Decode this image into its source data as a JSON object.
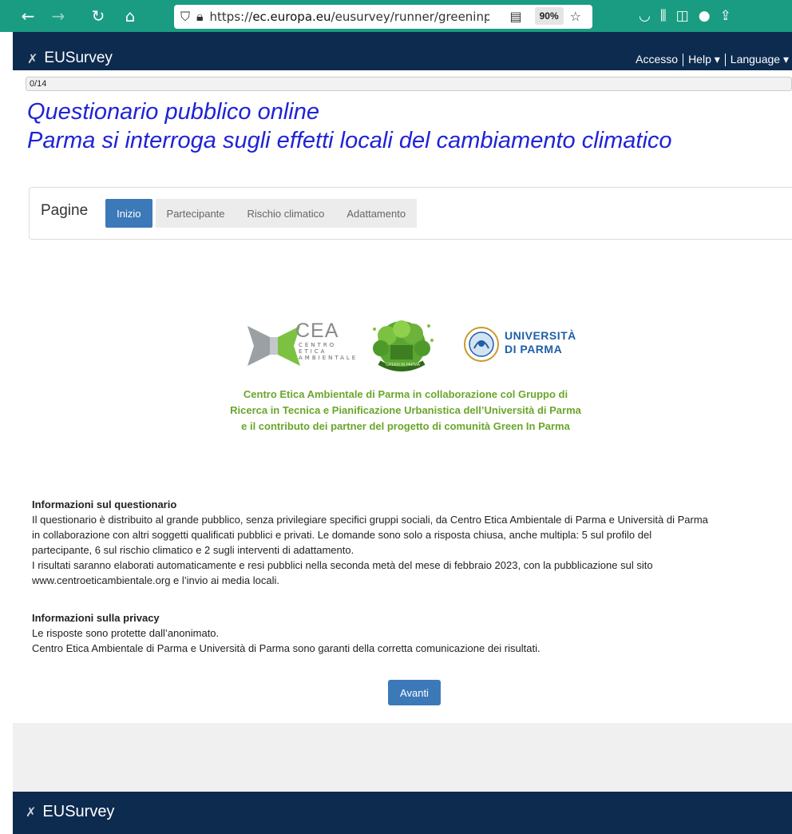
{
  "browser": {
    "url_prefix": "https://",
    "url_domain": "ec.europa.eu",
    "url_path": "/eusurvey/runner/greeninpar",
    "zoom": "90%"
  },
  "header": {
    "brand": "EUSurvey",
    "menu": [
      "Accesso",
      "Help ▾",
      "Language ▾"
    ]
  },
  "progress": {
    "label": "0/14",
    "value": 0
  },
  "survey": {
    "title_line1": "Questionario pubblico online",
    "title_line2": "Parma si interroga sugli effetti locali del cambiamento climatico"
  },
  "pages": {
    "label": "Pagine",
    "tabs": [
      "Inizio",
      "Partecipante",
      "Rischio climatico",
      "Adattamento"
    ],
    "active": "Inizio"
  },
  "logos": {
    "cea": "CEA",
    "cea_sub": [
      "CENTRO",
      "ETICA",
      "AMBIENTALE"
    ],
    "green": "GREEN IN PARMA",
    "uni": [
      "UNIVERSITÀ",
      "DI PARMA"
    ]
  },
  "partners": [
    "Centro Etica Ambientale di Parma in collaborazione col Gruppo di",
    "Ricerca in Tecnica e Pianificazione Urbanistica dell’Università di Parma",
    "e il contributo dei partner del progetto di comunità Green In Parma"
  ],
  "info_questionario": {
    "heading": "Informazioni sul questionario",
    "lines": [
      "Il questionario è distribuito al grande pubblico, senza privilegiare specifici gruppi sociali, da Centro Etica Ambientale di Parma e Università di Parma",
      "in collaborazione con altri soggetti qualificati pubblici e privati. Le domande sono solo a risposta chiusa, anche multipla: 5 sul profilo del",
      "partecipante, 6 sul rischio climatico e 2 sugli interventi di adattamento.",
      "I risultati saranno elaborati automaticamente e resi pubblici nella seconda metà del mese di febbraio 2023, con la pubblicazione sul sito",
      "www.centroeticambientale.org e l’invio ai media locali."
    ]
  },
  "info_privacy": {
    "heading": "Informazioni sulla privacy",
    "lines": [
      "Le risposte sono protette dall’anonimato.",
      "Centro Etica Ambientale di Parma e Università di Parma sono garanti della corretta comunicazione dei risultati."
    ]
  },
  "next_button": "Avanti",
  "footer": {
    "brand": "EUSurvey"
  }
}
